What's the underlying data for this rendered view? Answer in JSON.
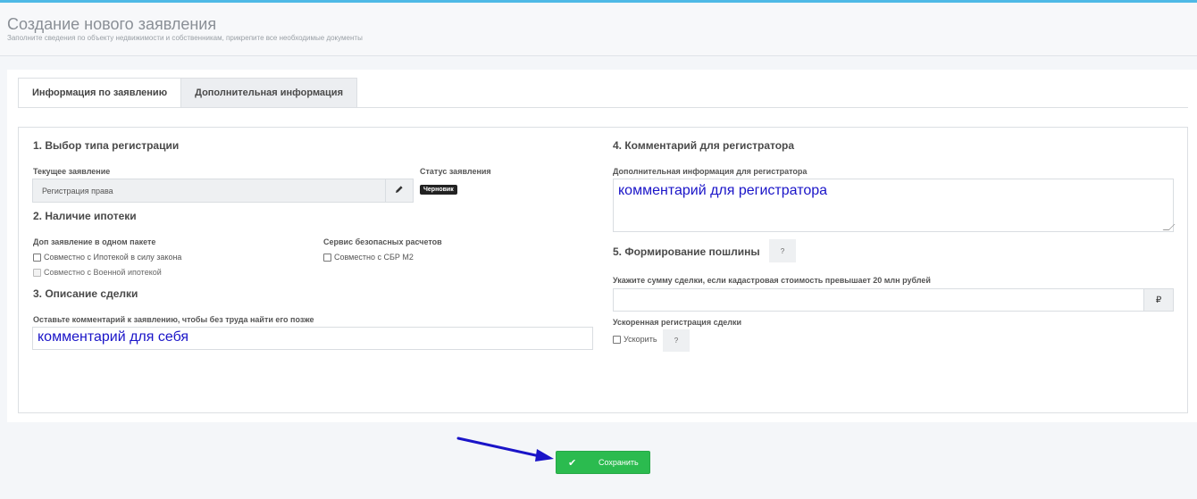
{
  "header": {
    "title": "Создание нового заявления",
    "subtitle": "Заполните сведения по объекту недвижимости и собственникам, прикрепите все необходимые документы"
  },
  "tabs": [
    {
      "label": "Информация по заявлению",
      "active": true
    },
    {
      "label": "Дополнительная информация",
      "active": false
    }
  ],
  "section1": {
    "title": "1. Выбор типа регистрации",
    "current_label": "Текущее заявление",
    "current_value": "Регистрация права",
    "status_label": "Статус заявления",
    "status_value": "Черновик"
  },
  "section2": {
    "title": "2. Наличие ипотеки",
    "package_label": "Доп заявление в одном пакете",
    "option_mortgage_law": "Совместно с Ипотекой в силу закона",
    "option_military": "Совместно с Военной ипотекой",
    "safe_label": "Сервис безопасных расчетов",
    "option_sbr": "Совместно с СБР М2"
  },
  "section3": {
    "title": "3. Описание сделки",
    "comment_label": "Оставьте комментарий к заявлению, чтобы без труда найти его позже",
    "comment_value": "комментарий для себя"
  },
  "section4": {
    "title": "4. Комментарий для регистратора",
    "info_label": "Дополнительная информация для регистратора",
    "info_value": "комментарий для регистратора"
  },
  "section5": {
    "title": "5. Формирование пошлины",
    "help": "?",
    "amount_label": "Укажите сумму сделки, если кадастровая стоимость превышает 20 млн рублей",
    "amount_value": "",
    "currency": "₽",
    "fast_label": "Ускоренная регистрация сделки",
    "fast_option": "Ускорить",
    "fast_help": "?"
  },
  "footer": {
    "save_label": "Сохранить"
  },
  "colors": {
    "accent": "#4fb9e6",
    "save": "#2bbb4f",
    "annotation": "#1a14c8"
  }
}
